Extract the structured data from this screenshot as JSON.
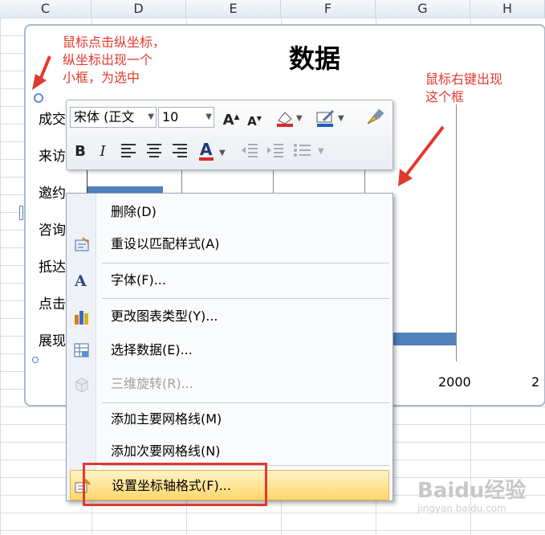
{
  "spreadsheet": {
    "columns": [
      "C",
      "D",
      "E",
      "F",
      "G",
      "H"
    ]
  },
  "chart": {
    "title": "数据",
    "categories": [
      "成交",
      "来访",
      "邀约",
      "咨询",
      "抵达",
      "点击",
      "展现"
    ],
    "x_tick": "2000",
    "x_tick_partial": "2"
  },
  "annotations": {
    "left": "鼠标点击纵坐标，\n纵坐标出现一个\n小框，为选中",
    "right": "鼠标右键出现\n这个框"
  },
  "mini_toolbar": {
    "font_name": "宋体 (正文",
    "font_size": "10",
    "bold": "B",
    "italic": "I"
  },
  "context_menu": {
    "items": [
      {
        "label": "删除(D)",
        "icon": "none",
        "disabled": false
      },
      {
        "label": "重设以匹配样式(A)",
        "icon": "reset-style-icon",
        "disabled": false
      },
      {
        "label": "字体(F)...",
        "icon": "font-icon",
        "disabled": false
      },
      {
        "label": "更改图表类型(Y)...",
        "icon": "chart-type-icon",
        "disabled": false
      },
      {
        "label": "选择数据(E)...",
        "icon": "select-data-icon",
        "disabled": false
      },
      {
        "label": "三维旋转(R)...",
        "icon": "3d-rotation-icon",
        "disabled": true
      },
      {
        "label": "添加主要网格线(M)",
        "icon": "none",
        "disabled": false
      },
      {
        "label": "添加次要网格线(N)",
        "icon": "none",
        "disabled": false
      },
      {
        "label": "设置坐标轴格式(F)...",
        "icon": "format-axis-icon",
        "disabled": false,
        "highlighted": true
      }
    ]
  },
  "watermark": {
    "text": "Baidu经验",
    "sub": "jingyan.baidu.com"
  }
}
